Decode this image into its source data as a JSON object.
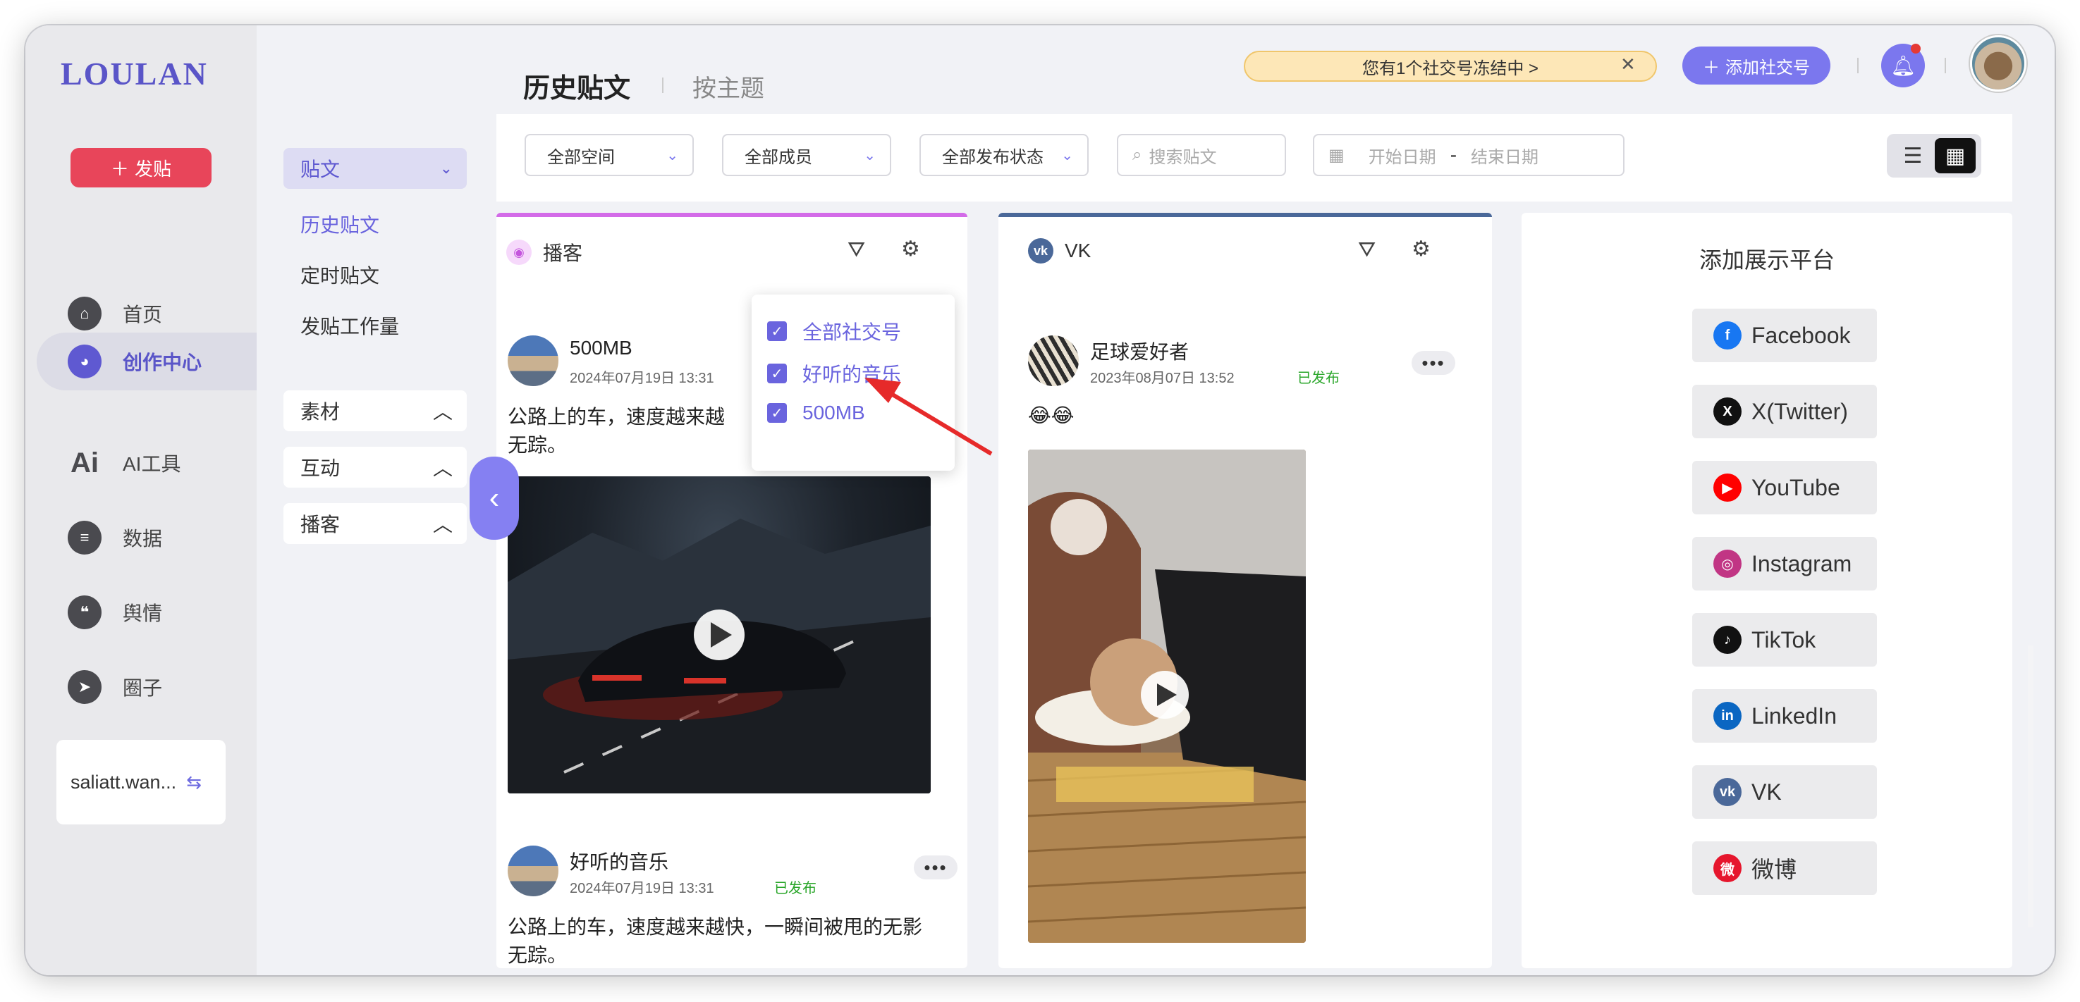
{
  "app": {
    "logo": "LOULAN",
    "post_button": "发贴"
  },
  "nav": {
    "items": [
      {
        "label": "首页",
        "icon": "home-icon"
      },
      {
        "label": "创作中心",
        "icon": "palette-icon",
        "active": true
      },
      {
        "label": "AI工具",
        "icon": "ai-icon"
      },
      {
        "label": "数据",
        "icon": "database-icon"
      },
      {
        "label": "舆情",
        "icon": "quote-icon"
      },
      {
        "label": "圈子",
        "icon": "compass-icon"
      }
    ],
    "user": "saliatt.wan..."
  },
  "subnav": {
    "head": "贴文",
    "links": [
      "历史贴文",
      "定时贴文",
      "发贴工作量"
    ],
    "sections": [
      "素材",
      "互动",
      "播客"
    ]
  },
  "header": {
    "title": "历史贴文",
    "tab2": "按主题",
    "notice": "您有1个社交号冻结中 >",
    "add_account": "添加社交号"
  },
  "filters": {
    "space": "全部空间",
    "member": "全部成员",
    "status": "全部发布状态",
    "search_placeholder": "搜索贴文",
    "start_date": "开始日期",
    "end_date": "结束日期",
    "range_sep": "-"
  },
  "columns": {
    "podcast": {
      "name": "播客",
      "accent": "#d36be8",
      "dropdown": [
        "全部社交号",
        "好听的音乐",
        "500MB"
      ],
      "posts": [
        {
          "author": "500MB",
          "time": "2024年07月19日 13:31",
          "text_line1": "公路上的车，速度越来越",
          "text_line2": "无踪。"
        },
        {
          "author": "好听的音乐",
          "time": "2024年07月19日 13:31",
          "status": "已发布",
          "text_line1": "公路上的车，速度越来越快，一瞬间被甩的无影",
          "text_line2": "无踪。"
        }
      ]
    },
    "vk": {
      "name": "VK",
      "accent": "#4a6899",
      "post": {
        "author": "足球爱好者",
        "time": "2023年08月07日 13:52",
        "status": "已发布",
        "text": "😂😂"
      }
    }
  },
  "platforms": {
    "title": "添加展示平台",
    "items": [
      {
        "label": "Facebook",
        "color": "#1877f2",
        "glyph": "f"
      },
      {
        "label": "X(Twitter)",
        "color": "#111111",
        "glyph": "X"
      },
      {
        "label": "YouTube",
        "color": "#ff0000",
        "glyph": "▶"
      },
      {
        "label": "Instagram",
        "color": "#c13584",
        "glyph": "◎"
      },
      {
        "label": "TikTok",
        "color": "#111111",
        "glyph": "♪"
      },
      {
        "label": "LinkedIn",
        "color": "#0a66c2",
        "glyph": "in"
      },
      {
        "label": "VK",
        "color": "#4a6899",
        "glyph": "vk"
      },
      {
        "label": "微博",
        "color": "#e6162d",
        "glyph": "微"
      }
    ]
  }
}
